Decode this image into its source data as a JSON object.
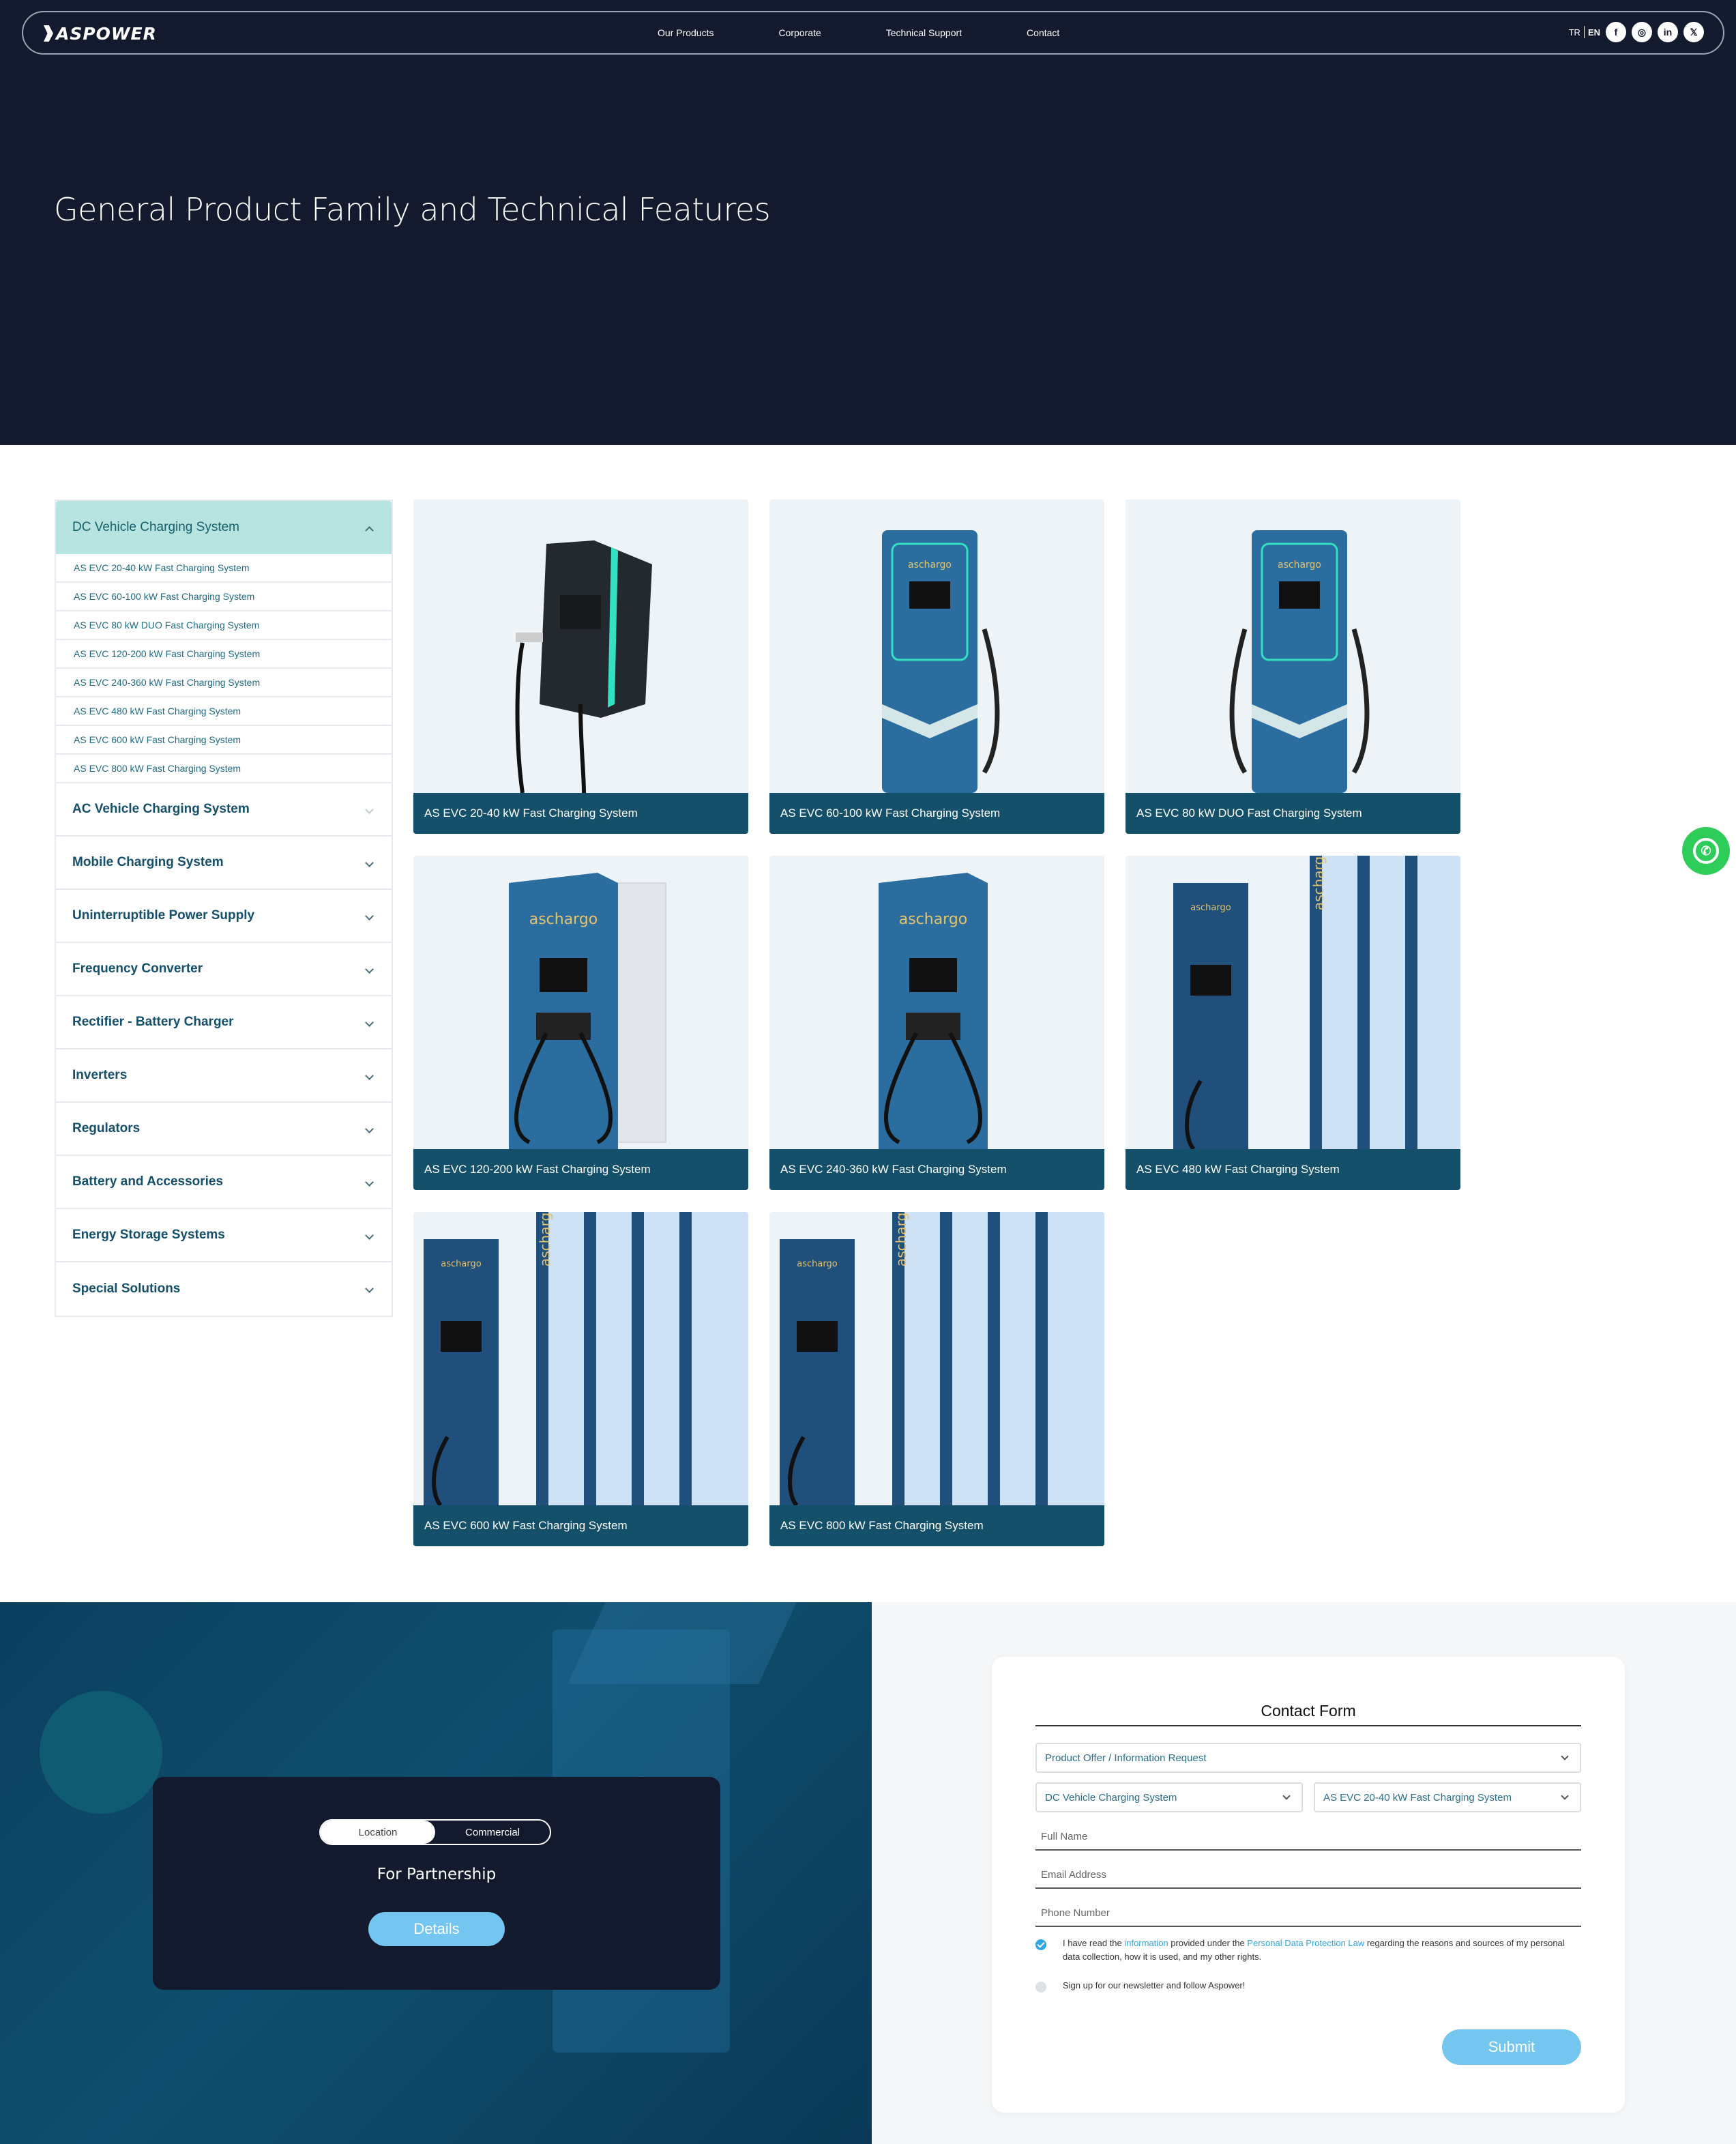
{
  "header": {
    "logo_text": "ASPOWER",
    "nav": [
      "Our Products",
      "Corporate",
      "Technical Support",
      "Contact"
    ],
    "lang_tr": "TR",
    "lang_en": "EN",
    "socials": [
      {
        "icon": "facebook-icon",
        "glyph": "f"
      },
      {
        "icon": "instagram-icon",
        "glyph": "◎"
      },
      {
        "icon": "linkedin-icon",
        "glyph": "in"
      },
      {
        "icon": "x-icon",
        "glyph": "𝕏"
      }
    ]
  },
  "hero": {
    "title": "General Product Family and Technical Features"
  },
  "sidebar": {
    "active_category": "DC Vehicle Charging System",
    "sub_items": [
      "AS EVC 20-40 kW Fast Charging System",
      "AS EVC 60-100 kW Fast Charging System",
      "AS EVC 80 kW DUO Fast Charging System",
      "AS EVC 120-200 kW Fast Charging System",
      "AS EVC 240-360 kW Fast Charging System",
      "AS EVC 480 kW Fast Charging System",
      "AS EVC 600 kW Fast Charging System",
      "AS EVC 800 kW Fast Charging System"
    ],
    "categories": [
      "AC Vehicle Charging System",
      "Mobile Charging System",
      "Uninterruptible Power Supply",
      "Frequency Converter",
      "Rectifier - Battery Charger",
      "Inverters",
      "Regulators",
      "Battery and Accessories",
      "Energy Storage Systems",
      "Special Solutions"
    ]
  },
  "products": [
    "AS EVC 20-40 kW Fast Charging System",
    "AS EVC 60-100 kW Fast Charging System",
    "AS EVC 80 kW DUO Fast Charging System",
    "AS EVC 120-200 kW Fast Charging System",
    "AS EVC 240-360 kW Fast Charging System",
    "AS EVC 480 kW Fast Charging System",
    "AS EVC 600 kW Fast Charging System",
    "AS EVC 800 kW Fast Charging System"
  ],
  "product_brand": "aschargo",
  "partnership": {
    "tab_location": "Location",
    "tab_commercial": "Commercial",
    "text": "For Partnership",
    "button": "Details"
  },
  "form": {
    "title": "Contact Form",
    "request_type": "Product Offer / Information Request",
    "category": "DC Vehicle Charging System",
    "product": "AS EVC 20-40 kW Fast Charging System",
    "full_name_placeholder": "Full Name",
    "email_placeholder": "Email Address",
    "phone_placeholder": "Phone Number",
    "consent_pre": "I have read the ",
    "consent_link1": "information",
    "consent_mid": " provided under the ",
    "consent_link2": "Personal Data Protection Law",
    "consent_post": " regarding the reasons and sources of my personal data collection, how it is used, and my other rights.",
    "newsletter": "Sign up for our newsletter and follow Aspower!",
    "submit": "Submit"
  },
  "colors": {
    "hero_bg": "#131a2e",
    "accent": "#74c6f0",
    "caption_bg": "#145069",
    "active_tab": "#b7e3e1",
    "whatsapp": "#2ecc59"
  }
}
